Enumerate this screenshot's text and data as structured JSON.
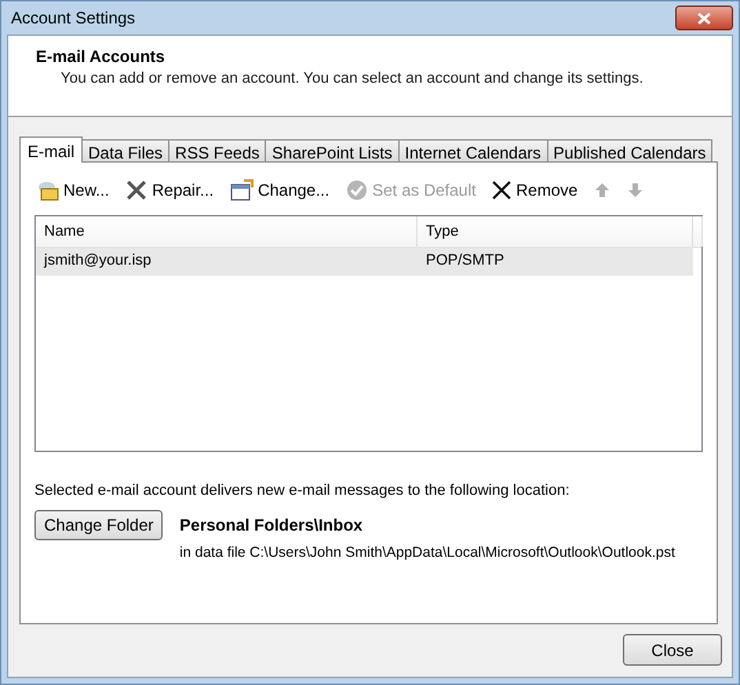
{
  "window": {
    "title": "Account Settings"
  },
  "header": {
    "title": "E-mail Accounts",
    "subtitle": "You can add or remove an account. You can select an account and change its settings."
  },
  "tabs": [
    {
      "label": "E-mail",
      "selected": true
    },
    {
      "label": "Data Files",
      "selected": false
    },
    {
      "label": "RSS Feeds",
      "selected": false
    },
    {
      "label": "SharePoint Lists",
      "selected": false
    },
    {
      "label": "Internet Calendars",
      "selected": false
    },
    {
      "label": "Published Calendars",
      "selected": false
    }
  ],
  "toolbar": [
    {
      "kind": "new",
      "label": "New...",
      "disabled": false
    },
    {
      "kind": "repair",
      "label": "Repair...",
      "disabled": false
    },
    {
      "kind": "change",
      "label": "Change...",
      "disabled": false
    },
    {
      "kind": "default",
      "label": "Set as Default",
      "disabled": true
    },
    {
      "kind": "remove",
      "label": "Remove",
      "disabled": false
    },
    {
      "kind": "up",
      "disabled": true
    },
    {
      "kind": "down",
      "disabled": true
    }
  ],
  "table": {
    "columns": [
      "Name",
      "Type"
    ],
    "rows": [
      {
        "cells": [
          "jsmith@your.isp",
          "POP/SMTP"
        ],
        "selected": true
      }
    ]
  },
  "delivery": {
    "caption": "Selected e-mail account delivers new e-mail messages to the following location:",
    "button": "Change Folder",
    "folder": "Personal Folders\\Inbox",
    "path": "in data file C:\\Users\\John Smith\\AppData\\Local\\Microsoft\\Outlook\\Outlook.pst"
  },
  "buttons": [
    "Close"
  ]
}
